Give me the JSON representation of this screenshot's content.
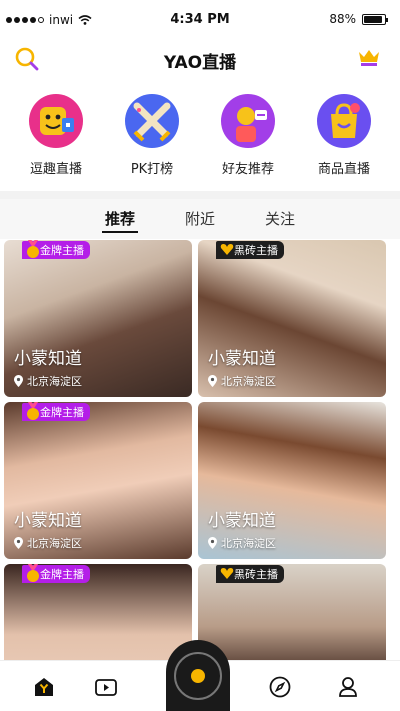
{
  "status_bar": {
    "carrier": "inwi",
    "time": "4:34 PM",
    "battery": "88%",
    "battery_level": 0.88
  },
  "nav": {
    "title": "YAO直播"
  },
  "categories": [
    {
      "label": "逗趣直播",
      "icon": "funny-face-icon",
      "color": "#e8308a"
    },
    {
      "label": "PK打榜",
      "icon": "crossed-swords-icon",
      "color": "#4a67f0"
    },
    {
      "label": "好友推荐",
      "icon": "friend-recommend-icon",
      "color": "#a23ee8"
    },
    {
      "label": "商品直播",
      "icon": "shopping-bag-icon",
      "color": "#6a4ff0"
    }
  ],
  "tabs": [
    {
      "label": "推荐",
      "active": true
    },
    {
      "label": "附近",
      "active": false
    },
    {
      "label": "关注",
      "active": false
    }
  ],
  "cards": [
    {
      "badge": "金牌主播",
      "badge_type": "gold",
      "name": "小蒙知道",
      "location": "北京海淀区"
    },
    {
      "badge": "黑砖主播",
      "badge_type": "brick",
      "name": "小蒙知道",
      "location": "北京海淀区"
    },
    {
      "badge": "金牌主播",
      "badge_type": "gold",
      "name": "小蒙知道",
      "location": "北京海淀区"
    },
    {
      "badge": "",
      "badge_type": "none",
      "name": "小蒙知道",
      "location": "北京海淀区"
    },
    {
      "badge": "金牌主播",
      "badge_type": "gold",
      "name": "",
      "location": ""
    },
    {
      "badge": "黑砖主播",
      "badge_type": "brick",
      "name": "",
      "location": ""
    }
  ],
  "tabbar": {
    "items": [
      "home-y-icon",
      "video-play-icon",
      "live-record-icon",
      "compass-icon",
      "profile-icon"
    ],
    "accent": "#f7b500"
  }
}
